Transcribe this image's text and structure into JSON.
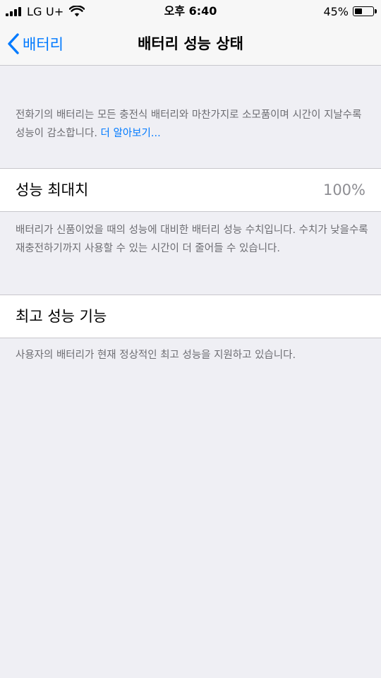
{
  "status_bar": {
    "carrier": "LG U+",
    "time": "오후 6:40",
    "battery_percent": "45%",
    "battery_level": 0.45
  },
  "nav": {
    "back_label": "배터리",
    "title": "배터리 성능 상태"
  },
  "intro": {
    "text": "전화기의 배터리는 모든 충전식 배터리와 마찬가지로 소모품이며 시간이 지날수록 성능이 감소합니다. ",
    "link": "더 알아보기..."
  },
  "maximum_capacity": {
    "label": "성능 최대치",
    "value": "100%",
    "description": "배터리가 신품이었을 때의 성능에 대비한 배터리 성능 수치입니다. 수치가 낮을수록 재충전하기까지 사용할 수 있는 시간이 더 줄어들 수 있습니다."
  },
  "peak_performance": {
    "label": "최고 성능 기능",
    "description": "사용자의 배터리가 현재 정상적인 최고 성능을 지원하고 있습니다."
  },
  "colors": {
    "accent": "#007aff",
    "background": "#efeff4",
    "footer_text": "#6d6d72"
  }
}
